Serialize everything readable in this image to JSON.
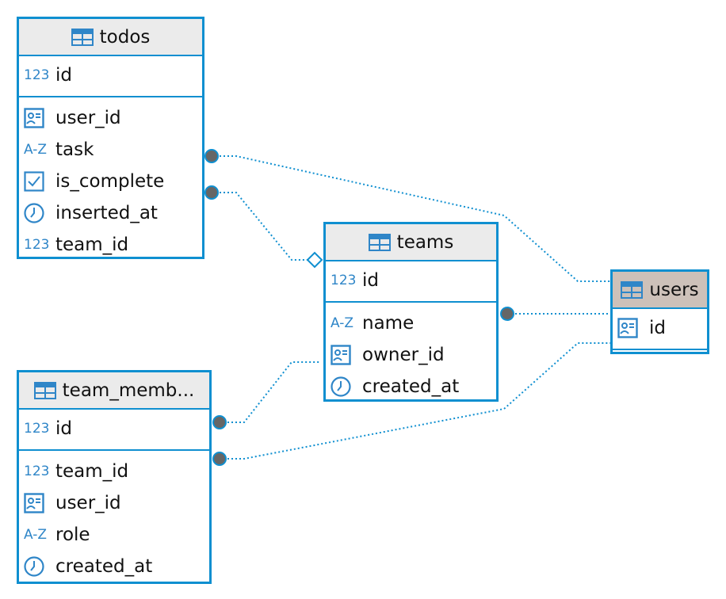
{
  "accent": "#0f8fd0",
  "tables": {
    "todos": {
      "name": "todos",
      "pk": [
        {
          "icon": "number-icon",
          "type": "123",
          "label": "id"
        }
      ],
      "cols": [
        {
          "icon": "id-card-icon",
          "type": "",
          "label": "user_id"
        },
        {
          "icon": "text-icon",
          "type": "A-Z",
          "label": "task"
        },
        {
          "icon": "checkbox-icon",
          "type": "",
          "label": "is_complete"
        },
        {
          "icon": "clock-icon",
          "type": "",
          "label": "inserted_at"
        },
        {
          "icon": "number-icon",
          "type": "123",
          "label": "team_id"
        }
      ]
    },
    "teams": {
      "name": "teams",
      "pk": [
        {
          "icon": "number-icon",
          "type": "123",
          "label": "id"
        }
      ],
      "cols": [
        {
          "icon": "text-icon",
          "type": "A-Z",
          "label": "name"
        },
        {
          "icon": "id-card-icon",
          "type": "",
          "label": "owner_id"
        },
        {
          "icon": "clock-icon",
          "type": "",
          "label": "created_at"
        }
      ]
    },
    "users": {
      "name": "users",
      "pk": [
        {
          "icon": "id-card-icon",
          "type": "",
          "label": "id"
        }
      ],
      "cols": []
    },
    "team_members": {
      "name": "team_memb...",
      "pk": [
        {
          "icon": "number-icon",
          "type": "123",
          "label": "id"
        }
      ],
      "cols": [
        {
          "icon": "number-icon",
          "type": "123",
          "label": "team_id"
        },
        {
          "icon": "id-card-icon",
          "type": "",
          "label": "user_id"
        },
        {
          "icon": "text-icon",
          "type": "A-Z",
          "label": "role"
        },
        {
          "icon": "clock-icon",
          "type": "",
          "label": "created_at"
        }
      ]
    }
  }
}
